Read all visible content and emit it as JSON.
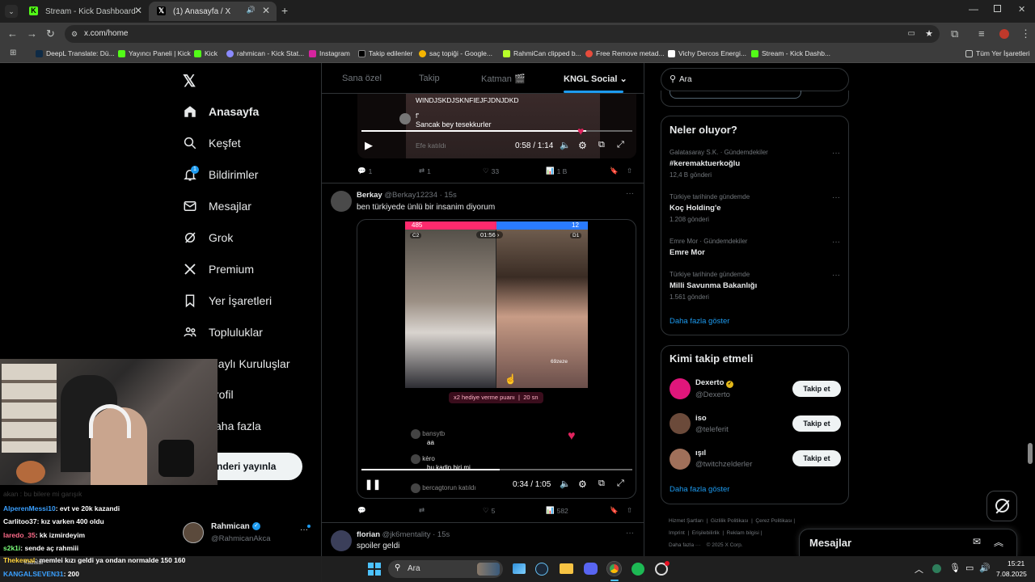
{
  "browser": {
    "tabs": [
      {
        "title": "Stream - Kick Dashboard",
        "icon": "kick-icon",
        "active": false
      },
      {
        "title": "(1) Anasayfa / X",
        "icon": "x-icon",
        "active": true
      }
    ],
    "url": "x.com/home",
    "bookmarks": [
      {
        "label": "DeepL Translate: Dü..."
      },
      {
        "label": "Yayıncı Paneli | Kick"
      },
      {
        "label": "Kick"
      },
      {
        "label": "rahmican - Kick Stat..."
      },
      {
        "label": "Instagram"
      },
      {
        "label": "Takip edilenler"
      },
      {
        "label": "saç topiği - Google..."
      },
      {
        "label": "RahmiCan clipped b..."
      },
      {
        "label": "Free Remove metad..."
      },
      {
        "label": "Vichy Dercos Energi..."
      },
      {
        "label": "Stream - Kick Dashb..."
      }
    ],
    "all_bookmarks": "Tüm Yer İşaretleri"
  },
  "nav": {
    "items": [
      {
        "label": "Anasayfa",
        "icon": "home-icon"
      },
      {
        "label": "Keşfet",
        "icon": "search-icon"
      },
      {
        "label": "Bildirimler",
        "icon": "bell-icon",
        "badge": "1"
      },
      {
        "label": "Mesajlar",
        "icon": "mail-icon"
      },
      {
        "label": "Grok",
        "icon": "grok-icon"
      },
      {
        "label": "Premium",
        "icon": "x-icon"
      },
      {
        "label": "Yer İşaretleri",
        "icon": "bookmark-icon"
      },
      {
        "label": "Topluluklar",
        "icon": "communities-icon"
      },
      {
        "label": "naylı Kuruluşlar",
        "icon": "verified-orgs-icon"
      },
      {
        "label": "rofil",
        "icon": "profile-icon"
      },
      {
        "label": "aha fazla",
        "icon": "more-icon"
      }
    ],
    "post_button": "nderi yayınla",
    "account": {
      "name": "Rahmican",
      "handle": "@RahmicanAkca"
    }
  },
  "feed": {
    "tabs": [
      "Sana özel",
      "Takip",
      "Katman 🎬",
      "KNGL Social"
    ],
    "active_tab": "KNGL Social",
    "tweet1": {
      "overlay_lines": [
        "WINDJSKDJSKNFIEJFJDNJDKD",
        "f'",
        "Sancak bey tesekkurler",
        "Efe katıldı"
      ],
      "video_time": "0:58 / 1:14",
      "progress": 0.83,
      "stats": {
        "replies": "1",
        "reposts": "1",
        "likes": "33",
        "views": "1 B"
      }
    },
    "tweet2": {
      "name": "Berkay",
      "handle": "@Berkay12234",
      "time": "· 15s",
      "text": "ben türkiyede ünlü bir insanim diyorum",
      "live": {
        "left_score": "485",
        "right_score": "12",
        "timer": "01:56",
        "left_tag": "C2",
        "right_tag": "D1",
        "viewers": "69zeze"
      },
      "gift_text": "x2 hediye verme puanı",
      "gift_time": "20 sn",
      "comments": [
        {
          "user": "bansytb",
          "text": "aa"
        },
        {
          "user": "kèro",
          "text": "bu kadin biri mi"
        },
        {
          "user": "bercagtorun",
          "text": "katıldı"
        }
      ],
      "video_time": "0:34 / 1:05",
      "progress": 0.51,
      "stats": {
        "replies": "",
        "reposts": "",
        "likes": "5",
        "views": "582"
      }
    },
    "tweet3": {
      "name": "florian",
      "handle": "@jk6mentality",
      "time": "· 15s",
      "text": "spoiler geldi"
    }
  },
  "right": {
    "search_placeholder": "Ara",
    "trends_title": "Neler oluyor?",
    "trends": [
      {
        "category": "Galatasaray S.K. · Gündemdekiler",
        "name": "#keremaktuerkoğlu",
        "count": "12,4 B gönderi"
      },
      {
        "category": "Türkiye tarihinde gündemde",
        "name": "Koç Holding'e",
        "count": "1.208 gönderi"
      },
      {
        "category": "Emre Mor · Gündemdekiler",
        "name": "Emre Mor",
        "count": ""
      },
      {
        "category": "Türkiye tarihinde gündemde",
        "name": "Milli Savunma Bakanlığı",
        "count": "1.561 gönderi"
      }
    ],
    "show_more": "Daha fazla göster",
    "who_title": "Kimi takip etmeli",
    "who": [
      {
        "name": "Dexerto",
        "handle": "@Dexerto",
        "verified": true,
        "button": "Takip et",
        "avatar_color": "#e0167b"
      },
      {
        "name": "iso",
        "handle": "@teleferit",
        "verified": false,
        "button": "Takip et",
        "avatar_color": "#6b4a3a"
      },
      {
        "name": "ışıl",
        "handle": "@twitchzelderler",
        "verified": false,
        "button": "Takip et",
        "avatar_color": "#a0705a"
      }
    ],
    "who_more": "Daha fazla göster",
    "footer": [
      "Hizmet Şartları",
      "Gizlilik Politikası",
      "Çerez Politikası",
      "Imprint",
      "Erişilebilirlik",
      "Reklam bilgisi",
      "Daha fazla ···",
      "© 2025 X Corp."
    ],
    "messages": "Mesajlar"
  },
  "overlay": {
    "chat": [
      {
        "user": "AlperenMessi10",
        "text": ": evt ve 20k kazandi",
        "color": "#3aa0ff"
      },
      {
        "user": "Carlitoo37",
        "text": ": kız varken 400 oldu",
        "color": "#ffffff"
      },
      {
        "user": "laredo_35",
        "text": ": kk izmirdeyim",
        "color": "#ff6b8a"
      },
      {
        "user": "s2k1i",
        "text": ": sende aç rahmiii",
        "color": "#7cff7c"
      },
      {
        "user": "Thekemal",
        "text": ": memlei kızı geldi ya ondan normalde 150 160",
        "color": "#ffd23a"
      },
      {
        "user": "KANGALSEVEN31",
        "text": ": 200",
        "color": "#3aa0ff"
      }
    ],
    "faded_line": "akan : bu bilere mi garışık"
  },
  "taskbar": {
    "search": "Ara",
    "time": "15:21",
    "date": "7.08.2025",
    "weather": "Kazalar"
  }
}
